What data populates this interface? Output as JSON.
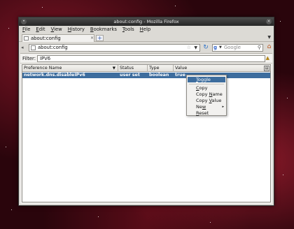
{
  "window": {
    "title": "about:config - Mozilla Firefox"
  },
  "menubar": [
    {
      "key": "F",
      "rest": "ile"
    },
    {
      "key": "E",
      "rest": "dit"
    },
    {
      "key": "V",
      "rest": "iew"
    },
    {
      "key": "H",
      "rest": "istory"
    },
    {
      "key": "B",
      "rest": "ookmarks"
    },
    {
      "key": "T",
      "rest": "ools"
    },
    {
      "key": "H",
      "rest": "elp"
    }
  ],
  "tab": {
    "title": "about:config"
  },
  "navbar": {
    "url": "about:config",
    "search_placeholder": "Google"
  },
  "filter": {
    "label": "Filter:",
    "value": "IPV6"
  },
  "table": {
    "headers": {
      "name": "Preference Name",
      "status": "Status",
      "type": "Type",
      "value": "Value"
    },
    "rows": [
      {
        "name": "network.dns.disableIPv6",
        "status": "user set",
        "type": "boolean",
        "value": "true"
      }
    ]
  },
  "context_menu": {
    "toggle": {
      "label": "Toggle",
      "key": "T",
      "rest": "oggle"
    },
    "copy": {
      "pre": "",
      "key": "C",
      "rest": "opy"
    },
    "copy_name": {
      "pre": "Copy ",
      "key": "N",
      "rest": "ame"
    },
    "copy_value": {
      "pre": "Copy ",
      "key": "V",
      "rest": "alue"
    },
    "new": {
      "pre": "Ne",
      "key": "w",
      "rest": ""
    },
    "reset": {
      "pre": "",
      "key": "R",
      "rest": "eset"
    }
  }
}
